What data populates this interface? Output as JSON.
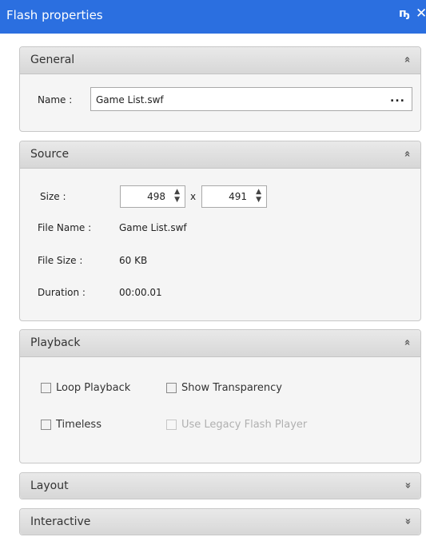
{
  "window": {
    "title": "Flash properties",
    "pin_icon": "pin-icon",
    "close_icon": "close-icon"
  },
  "general": {
    "header": "General",
    "name_label": "Name :",
    "name_value": "Game List.swf",
    "browse_label": "..."
  },
  "source": {
    "header": "Source",
    "size_label": "Size :",
    "width": "498",
    "times": "x",
    "height": "491",
    "file_name_label": "File Name :",
    "file_name": "Game List.swf",
    "file_size_label": "File Size :",
    "file_size": "60 KB",
    "duration_label": "Duration :",
    "duration": "00:00.01"
  },
  "playback": {
    "header": "Playback",
    "loop": "Loop Playback",
    "show_transparency": "Show Transparency",
    "timeless": "Timeless",
    "legacy": "Use Legacy Flash Player"
  },
  "layout": {
    "header": "Layout"
  },
  "interactive": {
    "header": "Interactive"
  },
  "icons": {
    "expanded": "»",
    "collapsed": "»"
  },
  "colors": {
    "titlebar": "#2b6fe0",
    "header_bg": "#dedede",
    "panel_bg": "#f5f5f5"
  }
}
